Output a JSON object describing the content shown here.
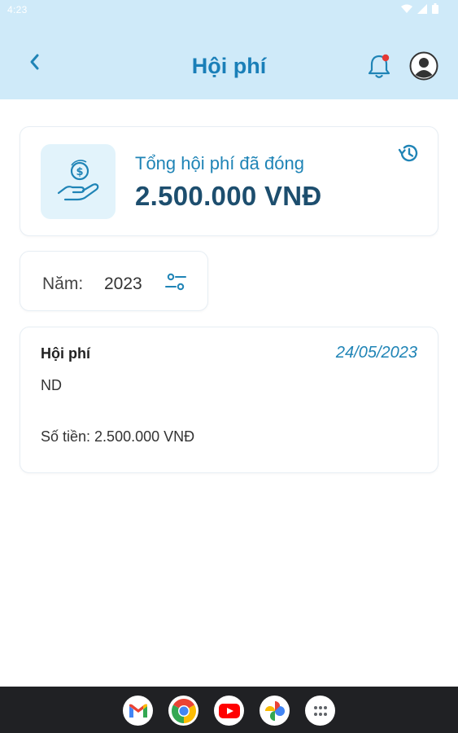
{
  "status_bar": {
    "time": "4:23"
  },
  "header": {
    "title": "Hội phí"
  },
  "summary": {
    "label": "Tổng hội phí đã đóng",
    "total": "2.500.000 VNĐ"
  },
  "filter": {
    "year_label": "Năm:",
    "year_value": "2023"
  },
  "fee_entries": [
    {
      "title": "Hội phí",
      "date": "24/05/2023",
      "code": "ND",
      "amount": "Số tiền: 2.500.000 VNĐ"
    }
  ],
  "dock_apps": [
    "gmail-icon",
    "chrome-icon",
    "youtube-icon",
    "photos-icon",
    "app-drawer-icon"
  ],
  "colors": {
    "header_bg": "#cfeaf9",
    "accent": "#1f84b6",
    "total_text": "#1d4e6e",
    "notification_dot": "#e53935"
  }
}
